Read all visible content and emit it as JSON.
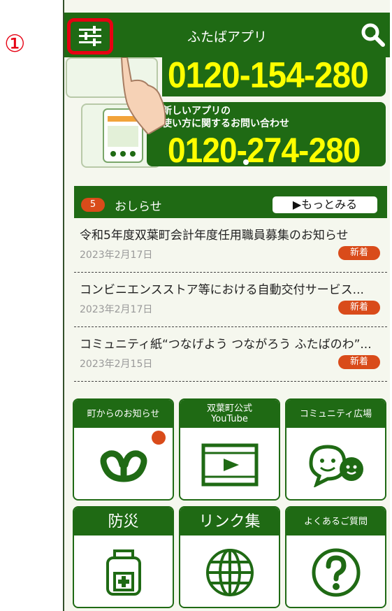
{
  "step_marker": "①",
  "app": {
    "title": "ふたばアプリ"
  },
  "banner": {
    "phone_1": "0120-154-280",
    "subtitle_line1": "新しいアプリの",
    "subtitle_line2": "使い方に関するお問い合わせ",
    "phone_2": "0120-274-280"
  },
  "news": {
    "count": "5",
    "title": "おしらせ",
    "more_label": "▶もっとみる",
    "items": [
      {
        "title": "令和5年度双葉町会計年度任用職員募集のお知らせ",
        "date": "2023年2月17日",
        "badge": "新着"
      },
      {
        "title": "コンビニエンスストア等における自動交付サービス...",
        "date": "2023年2月17日",
        "badge": "新着"
      },
      {
        "title": "コミュニティ紙“つなげよう つながろう ふたばのわ”...",
        "date": "2023年2月15日",
        "badge": "新着"
      }
    ]
  },
  "tiles": [
    {
      "label": "町からのお知らせ",
      "icon": "town-emblem-icon",
      "notification": true
    },
    {
      "label_line1": "双葉町公式",
      "label_line2": "YouTube",
      "icon": "video-play-icon"
    },
    {
      "label": "コミュニティ広場",
      "icon": "chat-faces-icon"
    },
    {
      "label": "防災",
      "icon": "emergency-bag-icon"
    },
    {
      "label": "リンク集",
      "icon": "globe-icon"
    },
    {
      "label": "よくあるご質問",
      "icon": "question-icon"
    }
  ],
  "colors": {
    "primary": "#1f6a14",
    "accent": "#d94b1a",
    "highlight": "#e60012",
    "phone_text": "#ffff00"
  }
}
